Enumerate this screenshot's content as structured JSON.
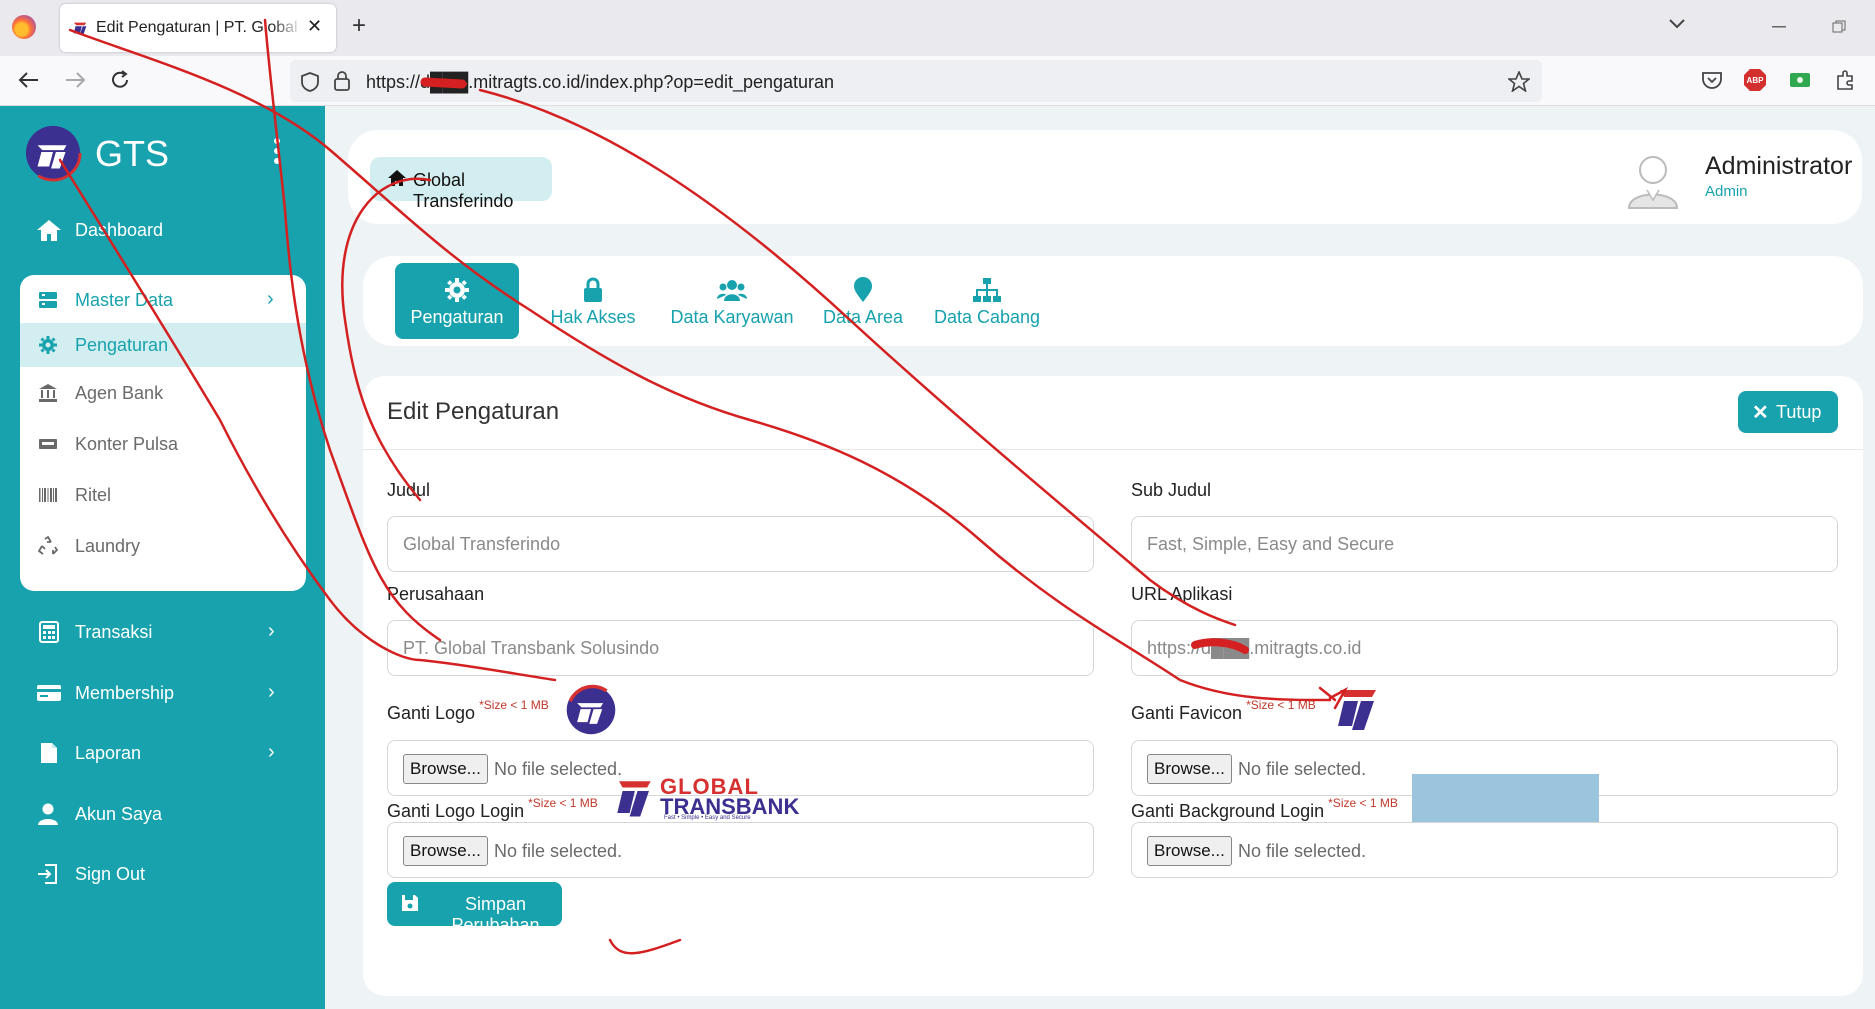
{
  "browser": {
    "tab_title": "Edit Pengaturan | PT. Global Transbank Solusindo",
    "url": "https://d███.mitragts.co.id/index.php?op=edit_pengaturan",
    "new_tab_label": "+",
    "close_tab_label": "✕"
  },
  "sidebar": {
    "brand": "GTS",
    "items": [
      {
        "label": "Dashboard",
        "icon": "home-icon"
      },
      {
        "label": "Transaksi",
        "icon": "calculator-icon"
      },
      {
        "label": "Membership",
        "icon": "card-icon"
      },
      {
        "label": "Laporan",
        "icon": "document-icon"
      },
      {
        "label": "Akun Saya",
        "icon": "user-icon"
      },
      {
        "label": "Sign Out",
        "icon": "sign-out-icon"
      }
    ],
    "submenu": [
      {
        "label": "Master Data",
        "icon": "database-icon"
      },
      {
        "label": "Pengaturan",
        "icon": "gear-icon"
      },
      {
        "label": "Agen Bank",
        "icon": "bank-icon"
      },
      {
        "label": "Konter Pulsa",
        "icon": "printer-icon"
      },
      {
        "label": "Ritel",
        "icon": "barcode-icon"
      },
      {
        "label": "Laundry",
        "icon": "recycle-icon"
      }
    ],
    "active_color": "#17a2ad"
  },
  "header": {
    "breadcrumb": "Global Transferindo",
    "user_name": "Administrator",
    "user_role": "Admin"
  },
  "settings_tabs": [
    {
      "label": "Pengaturan",
      "icon": "gear-icon",
      "active": true
    },
    {
      "label": "Hak Akses",
      "icon": "lock-icon",
      "active": false
    },
    {
      "label": "Data Karyawan",
      "icon": "users-icon",
      "active": false
    },
    {
      "label": "Data Area",
      "icon": "map-marker-icon",
      "active": false
    },
    {
      "label": "Data Cabang",
      "icon": "sitemap-icon",
      "active": false
    }
  ],
  "form": {
    "title": "Edit Pengaturan",
    "close_label": "Tutup",
    "judul_label": "Judul",
    "judul_value": "Global Transferindo",
    "sub_judul_label": "Sub Judul",
    "sub_judul_value": "Fast, Simple, Easy and Secure",
    "perusahaan_label": "Perusahaan",
    "perusahaan_value": "PT. Global Transbank Solusindo",
    "url_label": "URL Aplikasi",
    "url_value": "https://d███.mitragts.co.id",
    "logo_label": "Ganti Logo",
    "favicon_label": "Ganti Favicon",
    "logo_login_label": "Ganti Logo Login",
    "bg_login_label": "Ganti Background Login",
    "size_note": "*Size < 1 MB",
    "browse_label": "Browse...",
    "no_file": "No file selected.",
    "save_label": "Simpan Perubahan",
    "logo_login_text": "GLOBAL",
    "logo_login_text2": "TRANSBANK",
    "logo_login_tagline": "Fast • Simple • Easy and Secure"
  },
  "colors": {
    "primary": "#17a2ad",
    "annotation": "#d42020",
    "logo_navy": "#3b2f8f",
    "logo_red": "#d63031"
  }
}
